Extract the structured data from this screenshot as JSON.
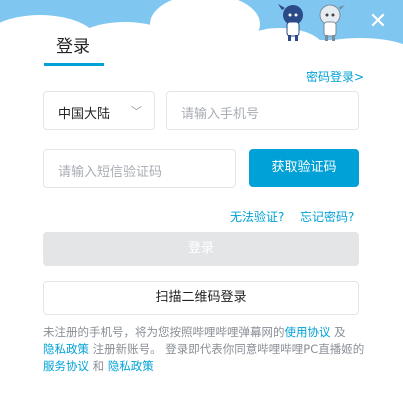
{
  "dialog": {
    "close_icon": "close-icon",
    "title": "登录",
    "password_login_link": "密码登录>",
    "region": {
      "selected": "中国大陆",
      "chevron_icon": "chevron-down-icon"
    },
    "phone_placeholder": "请输入手机号",
    "sms_placeholder": "请输入短信验证码",
    "get_code_button": "获取验证码",
    "cannot_verify_link": "无法验证?",
    "forgot_password_link": "忘记密码?",
    "login_button": "登录",
    "qr_login_button": "扫描二维码登录",
    "terms": {
      "part1": "未注册的手机号，将为您按照哔哩哔哩弹幕网的",
      "usage_link": "使用协议",
      "and1": " 及",
      "privacy_link1": "隐私政策",
      "part2": " 注册新账号。 登录即代表你同意哔哩哔哩PC直播姬的",
      "service_link": "服务协议",
      "and2": " 和 ",
      "privacy_link2": "隐私政策"
    }
  },
  "colors": {
    "accent": "#00a1d6",
    "sky": "#7fc6f0",
    "disabled": "#e3e5e7",
    "placeholder": "#a8adb3"
  }
}
